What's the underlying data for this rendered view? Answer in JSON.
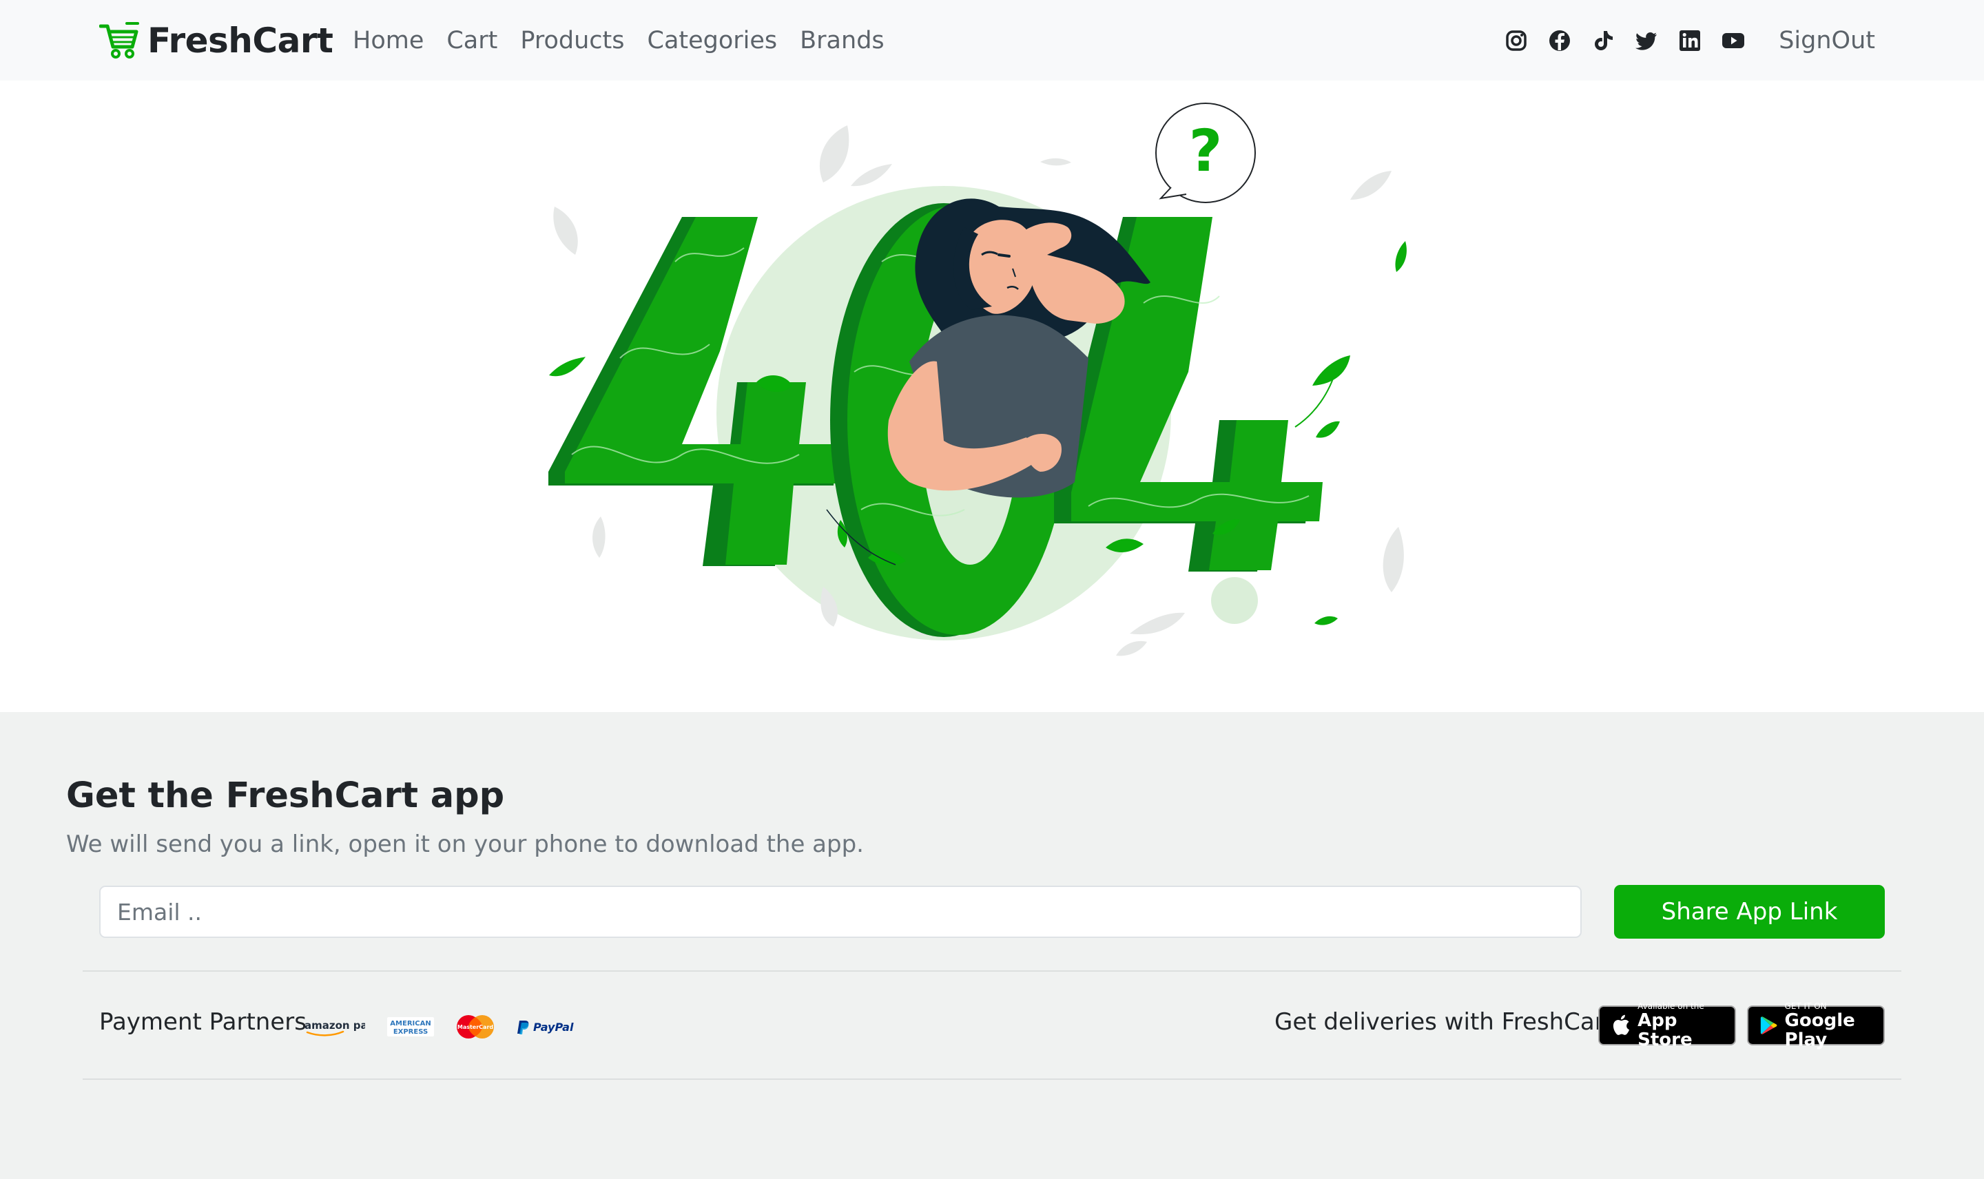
{
  "brand": {
    "name": "FreshCart",
    "icon": "shopping-cart-icon",
    "accent": "#0aad0a"
  },
  "nav": {
    "links": [
      {
        "label": "Home"
      },
      {
        "label": "Cart"
      },
      {
        "label": "Products"
      },
      {
        "label": "Categories"
      },
      {
        "label": "Brands"
      }
    ],
    "social": [
      "instagram-icon",
      "facebook-icon",
      "tiktok-icon",
      "twitter-icon",
      "linkedin-icon",
      "youtube-icon"
    ],
    "signout": "SignOut"
  },
  "hero": {
    "illustration": "404-not-found-illustration",
    "big_text": "404",
    "bubble": "?"
  },
  "footer": {
    "title": "Get the FreshCart app",
    "subtitle": "We will send you a link, open it on your phone to download the app.",
    "email_placeholder": "Email ..",
    "share_button": "Share App Link",
    "payment_label": "Payment Partners",
    "payment_logos": {
      "amazon": "amazon pay",
      "amex_top": "AMERICAN",
      "amex_bottom": "EXPRESS",
      "mastercard": "MasterCard",
      "paypal": "PayPal"
    },
    "delivery_label": "Get deliveries with FreshCart",
    "app_store": {
      "small": "Available on the",
      "big": "App Store"
    },
    "google_play": {
      "small": "GET IT ON",
      "big": "Google Play"
    }
  },
  "colors": {
    "accent": "#0aad0a",
    "navbar_bg": "#f8f9fa",
    "footer_bg": "#f0f2f1"
  }
}
